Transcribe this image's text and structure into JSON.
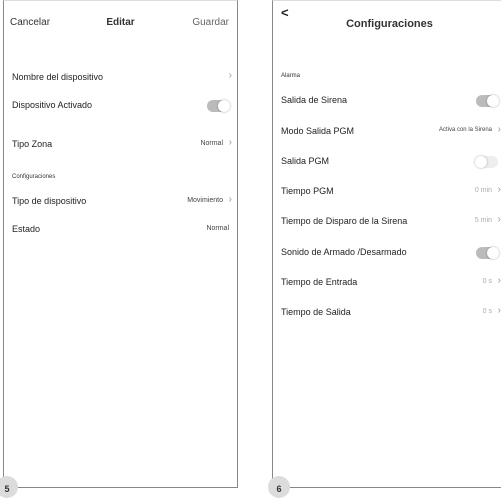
{
  "screen5": {
    "header": {
      "cancel": "Cancelar",
      "title": "Editar",
      "save": "Guardar"
    },
    "rows": {
      "device_name": {
        "label": "Nombre del dispositivo"
      },
      "device_active": {
        "label": "Dispositivo Activado",
        "on": true
      },
      "zone_type": {
        "label": "Tipo Zona",
        "value": "Normal"
      },
      "device_type": {
        "label": "Tipo de dispositivo",
        "value": "Movimiento"
      },
      "state": {
        "label": "Estado",
        "value": "Normal"
      }
    },
    "section_config": "Configuraciones",
    "page_number": "5"
  },
  "screen6": {
    "back": "<",
    "title": "Configuraciones",
    "section_alarm": "Alarma",
    "rows": {
      "siren_output": {
        "label": "Salida de Sirena",
        "on": true
      },
      "pgm_mode": {
        "label": "Modo Salida PGM",
        "value": "Activa con la Sirena"
      },
      "pgm_output": {
        "label": "Salida PGM",
        "on": false
      },
      "pgm_time": {
        "label": "Tiempo PGM",
        "value": "0 min"
      },
      "siren_time": {
        "label": "Tiempo de Disparo de la Sirena",
        "value": "5 min"
      },
      "arm_sound": {
        "label": "Sonido de Armado /Desarmado",
        "on": true
      },
      "entry_time": {
        "label": "Tiempo de Entrada",
        "value": "0 s"
      },
      "exit_time": {
        "label": "Tiempo de Salida",
        "value": "0 s"
      }
    },
    "page_number": "6"
  },
  "icons": {
    "chevron": "›"
  }
}
